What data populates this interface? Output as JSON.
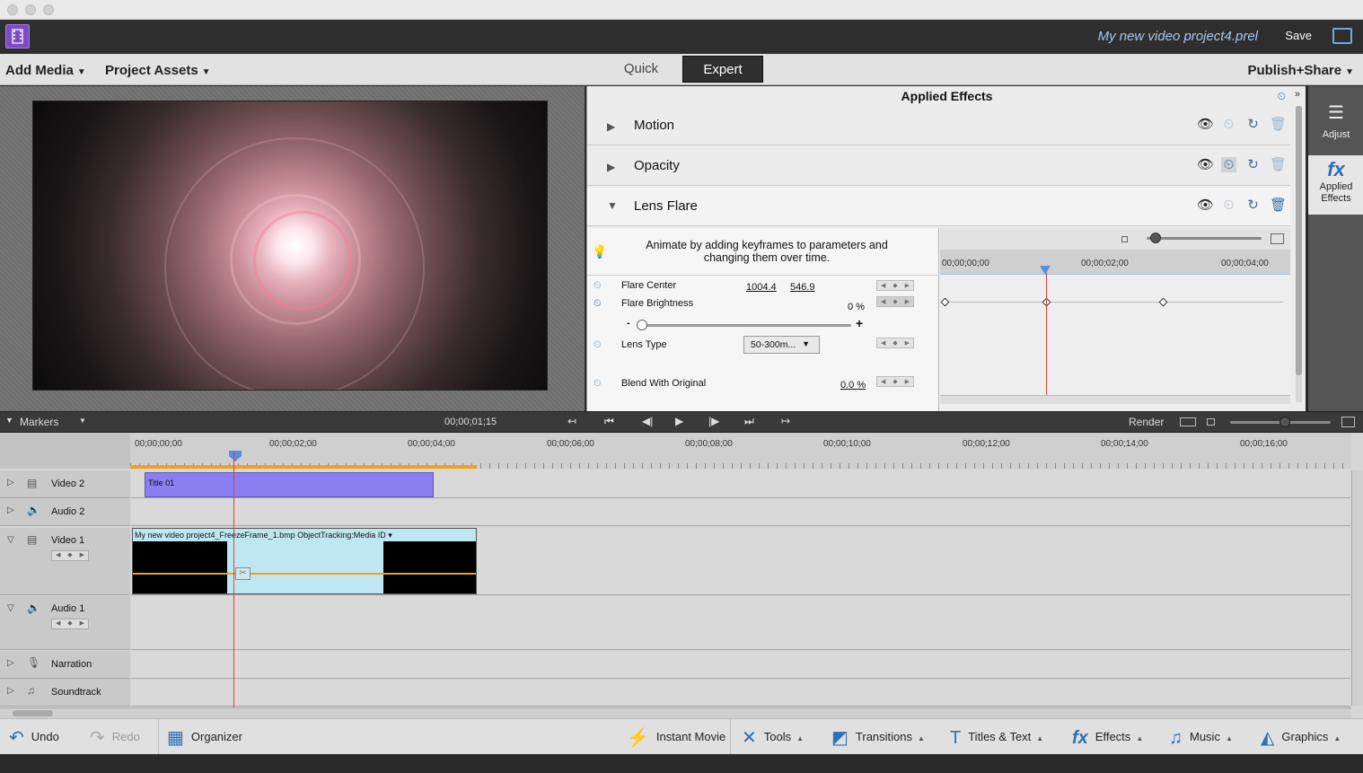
{
  "window": {
    "project_title": "My new video project4.prel",
    "save_label": "Save"
  },
  "menubar": {
    "add_media": "Add Media",
    "project_assets": "Project Assets",
    "quick": "Quick",
    "expert": "Expert",
    "publish_share": "Publish+Share"
  },
  "effects_panel": {
    "title": "Applied Effects",
    "effects": [
      {
        "name": "Motion",
        "expanded": false
      },
      {
        "name": "Opacity",
        "expanded": false
      },
      {
        "name": "Lens Flare",
        "expanded": true
      }
    ],
    "tip": "Animate by adding keyframes to parameters and changing them over time.",
    "params": {
      "flare_center_label": "Flare Center",
      "flare_center_x": "1004.4",
      "flare_center_y": "546.9",
      "flare_brightness_label": "Flare Brightness",
      "flare_brightness_value": "0 %",
      "lens_type_label": "Lens Type",
      "lens_type_value": "50-300m...",
      "blend_label": "Blend With Original",
      "blend_value": "0.0 %",
      "minus": "-",
      "plus": "+"
    },
    "keyframe_ruler": [
      "00;00;00;00",
      "00;00;02;00",
      "00;00;04;00"
    ]
  },
  "right_tools": {
    "adjust": "Adjust",
    "applied_effects_line1": "Applied",
    "applied_effects_line2": "Effects",
    "fx_glyph": "fx"
  },
  "timeline": {
    "markers_label": "Markers",
    "current_time": "00;00;01;15",
    "render_label": "Render",
    "ruler": [
      "00;00;00;00",
      "00;00;02;00",
      "00;00;04;00",
      "00;00;06;00",
      "00;00;08;00",
      "00;00;10;00",
      "00;00;12;00",
      "00;00;14;00",
      "00;00;16;00"
    ],
    "tracks": [
      {
        "name": "Video 2"
      },
      {
        "name": "Audio 2"
      },
      {
        "name": "Video 1"
      },
      {
        "name": "Audio 1"
      },
      {
        "name": "Narration"
      },
      {
        "name": "Soundtrack"
      }
    ],
    "title_clip": "Title 01",
    "video_clip": "My new video project4_FreezeFrame_1.bmp  ObjectTracking:Media ID ▾"
  },
  "bottom_bar": {
    "undo": "Undo",
    "redo": "Redo",
    "organizer": "Organizer",
    "instant_movie": "Instant Movie",
    "tools": "Tools",
    "transitions": "Transitions",
    "titles_text": "Titles & Text",
    "effects": "Effects",
    "music": "Music",
    "graphics": "Graphics"
  },
  "colors": {
    "accent_blue": "#3a6ea5",
    "title_clip": "#8a7ff0",
    "video_clip": "#bfe7f2",
    "playhead": "#e03c3c",
    "app_icon": "#7e4cc2"
  }
}
